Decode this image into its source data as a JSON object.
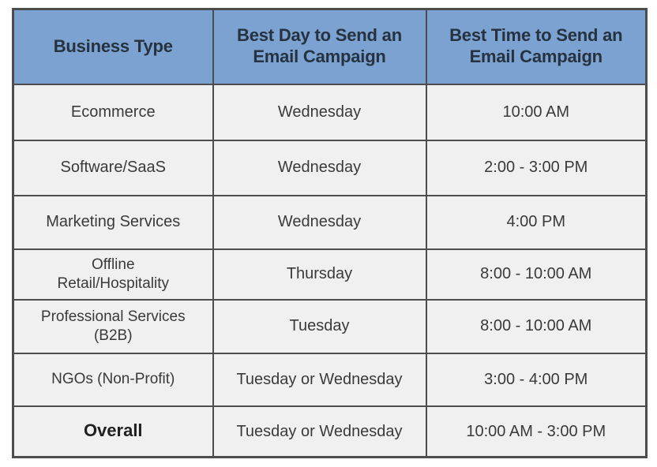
{
  "table": {
    "columns": [
      {
        "id": "business_type",
        "label_lines": [
          "Business Type"
        ]
      },
      {
        "id": "best_day",
        "label_lines": [
          "Best Day to Send an",
          "Email Campaign"
        ]
      },
      {
        "id": "best_time",
        "label_lines": [
          "Best Time to Send an",
          "Email Campaign"
        ]
      }
    ],
    "rows": [
      {
        "business_type_lines": [
          "Ecommerce"
        ],
        "best_day": "Wednesday",
        "best_time": "10:00 AM",
        "emphasis": false
      },
      {
        "business_type_lines": [
          "Software/SaaS"
        ],
        "best_day": "Wednesday",
        "best_time": "2:00 - 3:00 PM",
        "emphasis": false
      },
      {
        "business_type_lines": [
          "Marketing Services"
        ],
        "best_day": "Wednesday",
        "best_time": "4:00 PM",
        "emphasis": false
      },
      {
        "business_type_lines": [
          "Offline",
          "Retail/Hospitality"
        ],
        "best_day": "Thursday",
        "best_time": "8:00 - 10:00 AM",
        "emphasis": false
      },
      {
        "business_type_lines": [
          "Professional Services",
          "(B2B)"
        ],
        "best_day": "Tuesday",
        "best_time": "8:00 - 10:00 AM",
        "emphasis": false
      },
      {
        "business_type_lines": [
          "NGOs (Non-Profit)"
        ],
        "best_day": "Tuesday or Wednesday",
        "best_time": "3:00 - 4:00 PM",
        "emphasis": false
      },
      {
        "business_type_lines": [
          "Overall"
        ],
        "best_day": "Tuesday or Wednesday",
        "best_time": "10:00 AM - 3:00 PM",
        "emphasis": true
      }
    ]
  },
  "colors": {
    "header_background": "#7ba2d0",
    "header_text": "#26323f",
    "cell_background": "#f0f0f0",
    "cell_text": "#3a3a3a",
    "border": "#4d4d4d",
    "page_background": "#ffffff"
  }
}
